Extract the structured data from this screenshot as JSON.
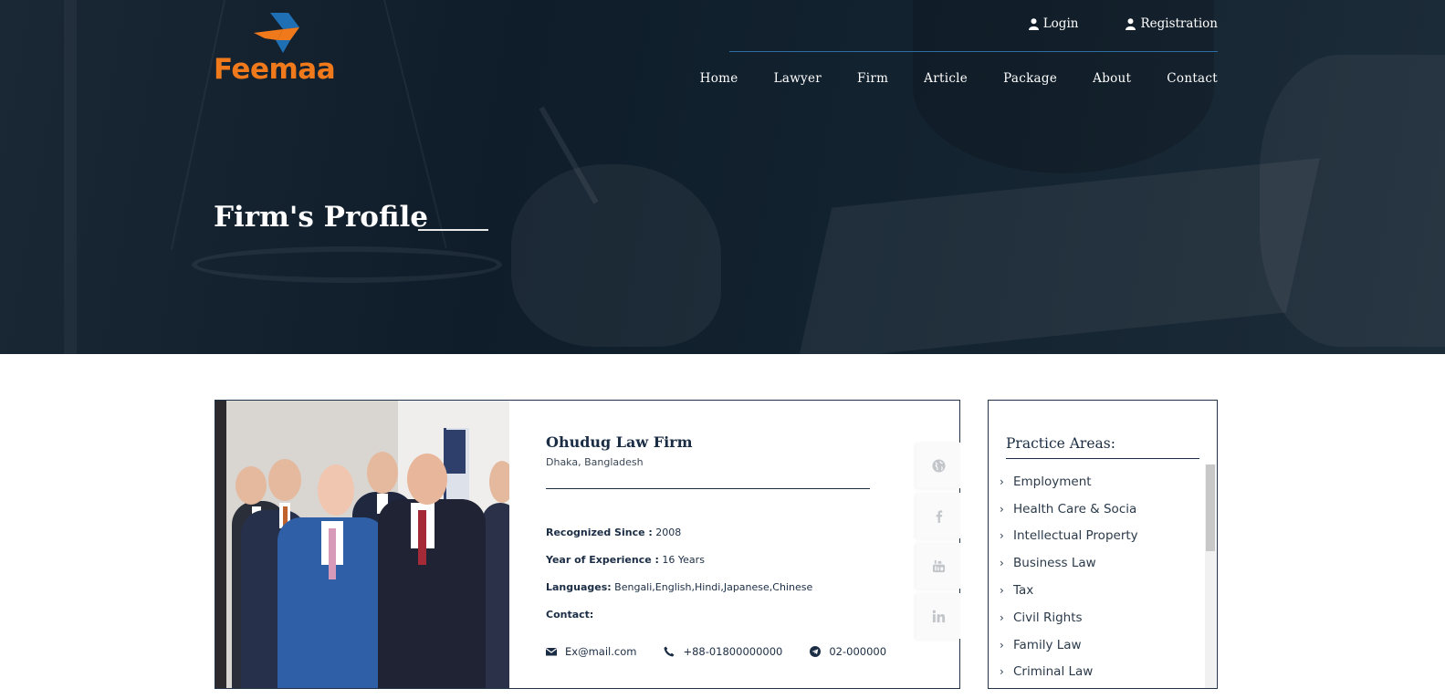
{
  "brand": {
    "name": "Feemaa",
    "accent_color": "#f07a1b",
    "secondary_color": "#1f6fb5"
  },
  "auth": {
    "login_label": "Login",
    "registration_label": "Registration"
  },
  "nav": {
    "items": [
      "Home",
      "Lawyer",
      "Firm",
      "Article",
      "Package",
      "About",
      "Contact"
    ]
  },
  "hero": {
    "title": "Firm's Profile"
  },
  "firm": {
    "name": "Ohudug Law Firm",
    "location": "Dhaka, Bangladesh",
    "recognized_label": "Recognized Since :",
    "recognized_value": "2008",
    "experience_label": "Year of Experience :",
    "experience_value": "16 Years",
    "languages_label": "Languages:",
    "languages_value": "Bengali,English,Hindi,Japanese,Chinese",
    "contact_label": "Contact:",
    "email": "Ex@mail.com",
    "phone": "+88-01800000000",
    "telegram": "02-000000",
    "social_icons": [
      "globe-icon",
      "facebook-icon",
      "youtube-icon",
      "linkedin-icon"
    ]
  },
  "practice": {
    "title": "Practice Areas:",
    "items": [
      "Employment",
      "Health Care & Socia",
      "Intellectual Property",
      "Business Law",
      "Tax",
      "Civil Rights",
      "Family Law",
      "Criminal Law"
    ]
  }
}
